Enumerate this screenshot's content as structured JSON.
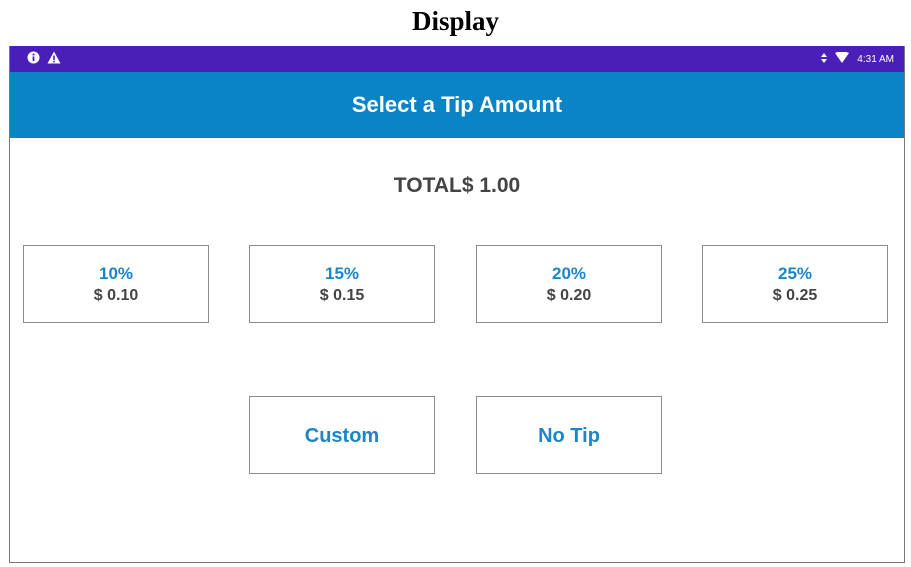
{
  "caption": "Display",
  "status_bar": {
    "left_icons": [
      "info-icon",
      "warning-icon"
    ],
    "right_icons": [
      "signal-icon",
      "wifi-icon"
    ],
    "time": "4:31 AM",
    "background": "#4a1fb8"
  },
  "app_bar": {
    "title": "Select a Tip Amount",
    "background": "#0a84c6"
  },
  "total": {
    "text": "TOTAL$ 1.00"
  },
  "tip_options": [
    {
      "percent": "10%",
      "amount": "$ 0.10"
    },
    {
      "percent": "15%",
      "amount": "$ 0.15"
    },
    {
      "percent": "20%",
      "amount": "$ 0.20"
    },
    {
      "percent": "25%",
      "amount": "$ 0.25"
    }
  ],
  "actions": {
    "custom_label": "Custom",
    "no_tip_label": "No Tip"
  },
  "colors": {
    "accent_text": "#1b86c7",
    "body_text": "#444444"
  }
}
